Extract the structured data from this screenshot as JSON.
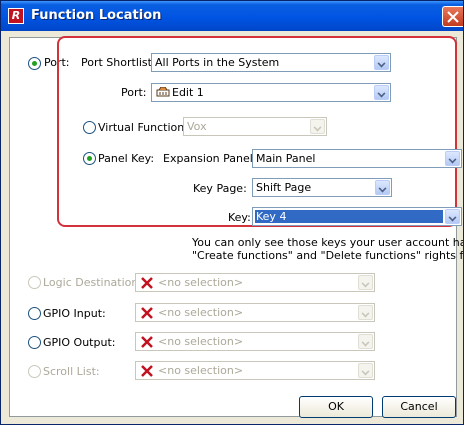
{
  "window": {
    "title": "Function Location"
  },
  "port": {
    "radio_label": "Port:",
    "shortlist_label": "Port Shortlist:",
    "shortlist_value": "All Ports in the System",
    "port_label": "Port:",
    "port_value": "Edit 1"
  },
  "virtual_function": {
    "label": "Virtual Function:",
    "value": "Vox"
  },
  "panel_key": {
    "label": "Panel Key:",
    "expansion_label": "Expansion Panel:",
    "expansion_value": "Main Panel",
    "key_page_label": "Key Page:",
    "key_page_value": "Shift Page",
    "key_label": "Key:",
    "key_value": "Key 4",
    "info_line1": "You can only see those keys your user account has the",
    "info_line2": "\"Create functions\" and \"Delete functions\" rights for."
  },
  "logic_destination": {
    "label": "Logic Destination:",
    "value": "<no selection>"
  },
  "gpio_input": {
    "label": "GPIO Input:",
    "value": "<no selection>"
  },
  "gpio_output": {
    "label": "GPIO Output:",
    "value": "<no selection>"
  },
  "scroll_list": {
    "label": "Scroll List:",
    "value": "<no selection>"
  },
  "buttons": {
    "ok": "OK",
    "cancel": "Cancel"
  },
  "colors": {
    "title_bar": "#0054e3",
    "highlight_box": "#d3323a",
    "selection": "#316ac5",
    "x_mark": "#c1121f"
  }
}
